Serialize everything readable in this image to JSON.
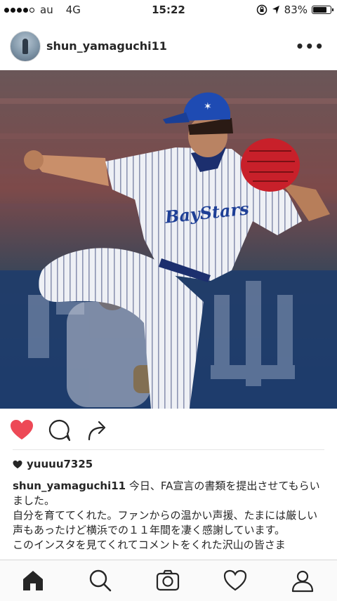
{
  "status_bar": {
    "carrier": "au",
    "network": "4G",
    "time": "15:22",
    "battery": "83%",
    "battery_level": 0.83
  },
  "post": {
    "username": "shun_yamaguchi11",
    "photo_text": "BayStars",
    "likes_user": "yuuuu7325",
    "caption_user": "shun_yamaguchi11",
    "caption_text": " 今日、FA宣言の書類を提出させてもらいました。\n自分を育ててくれた。ファンからの温かい声援、たまには厳しい声もあったけど横浜での１１年間を凄く感謝しています。\nこのインスタを見てくれてコメントをくれた沢山の皆さま"
  },
  "icons": {
    "more": "more-options-icon",
    "like": "heart-filled-icon",
    "comment": "comment-icon",
    "share": "share-icon",
    "home": "home-icon",
    "search": "search-icon",
    "camera": "camera-icon",
    "activity": "heart-outline-icon",
    "profile": "profile-icon"
  },
  "colors": {
    "like_red": "#ed4956",
    "text": "#262626",
    "cap_blue": "#1e4bb3",
    "glove_red": "#c8202a"
  }
}
